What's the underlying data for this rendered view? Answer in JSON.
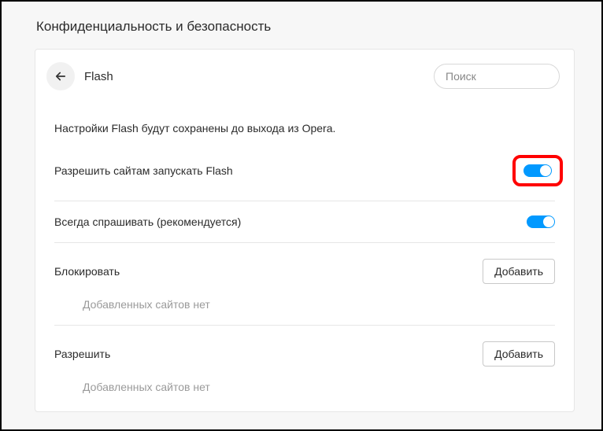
{
  "page": {
    "title": "Конфиденциальность и безопасность"
  },
  "header": {
    "title": "Flash",
    "search_placeholder": "Поиск"
  },
  "settings": {
    "info": "Настройки Flash будут сохранены до выхода из Opera.",
    "allow_flash": {
      "label": "Разрешить сайтам запускать Flash",
      "enabled": true
    },
    "always_ask": {
      "label": "Всегда спрашивать (рекомендуется)",
      "enabled": true
    }
  },
  "lists": {
    "block": {
      "label": "Блокировать",
      "add_label": "Добавить",
      "empty": "Добавленных сайтов нет"
    },
    "allow": {
      "label": "Разрешить",
      "add_label": "Добавить",
      "empty": "Добавленных сайтов нет"
    }
  }
}
